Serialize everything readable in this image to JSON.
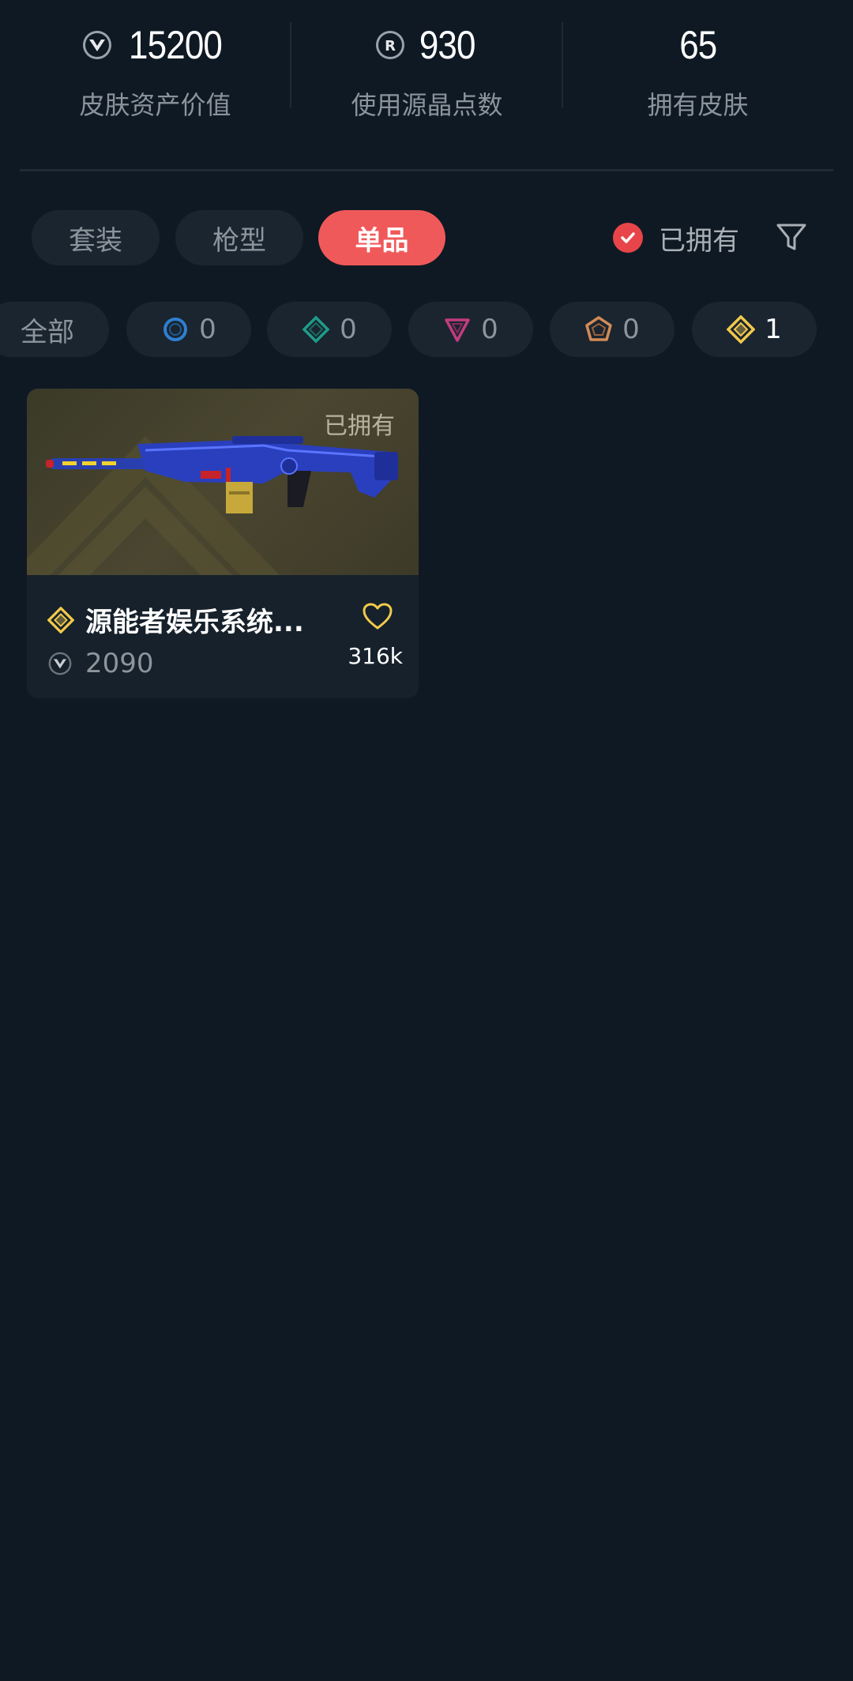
{
  "stats": [
    {
      "value": "15200",
      "label": "皮肤资产价值",
      "icon": "valorant-points-icon"
    },
    {
      "value": "930",
      "label": "使用源晶点数",
      "icon": "radianite-points-icon"
    },
    {
      "value": "65",
      "label": "拥有皮肤",
      "icon": ""
    }
  ],
  "tabs": [
    {
      "label": "套装",
      "active": false
    },
    {
      "label": "枪型",
      "active": false
    },
    {
      "label": "单品",
      "active": true
    }
  ],
  "owned_filter": {
    "label": "已拥有",
    "checked": true
  },
  "rarity_filters": [
    {
      "label": "全部"
    },
    {
      "count": "0",
      "icon": "select-tier-icon",
      "color": "#2f7fd0"
    },
    {
      "count": "0",
      "icon": "deluxe-tier-icon",
      "color": "#1f9c8a"
    },
    {
      "count": "0",
      "icon": "premium-tier-icon",
      "color": "#c23c7e"
    },
    {
      "count": "0",
      "icon": "ultra-tier-icon",
      "color": "#d38b56"
    },
    {
      "count": "1",
      "icon": "exclusive-tier-icon",
      "color": "#f2c94c"
    }
  ],
  "skins": [
    {
      "name": "源能者娱乐系统...",
      "owned_tag": "已拥有",
      "price": "2090",
      "likes": "316k",
      "tier_icon": "exclusive-tier-icon",
      "tier_color": "#f2c94c"
    }
  ],
  "colors": {
    "background": "#0f1923",
    "accent": "#f0595a",
    "chip_bg": "#1a2530"
  }
}
